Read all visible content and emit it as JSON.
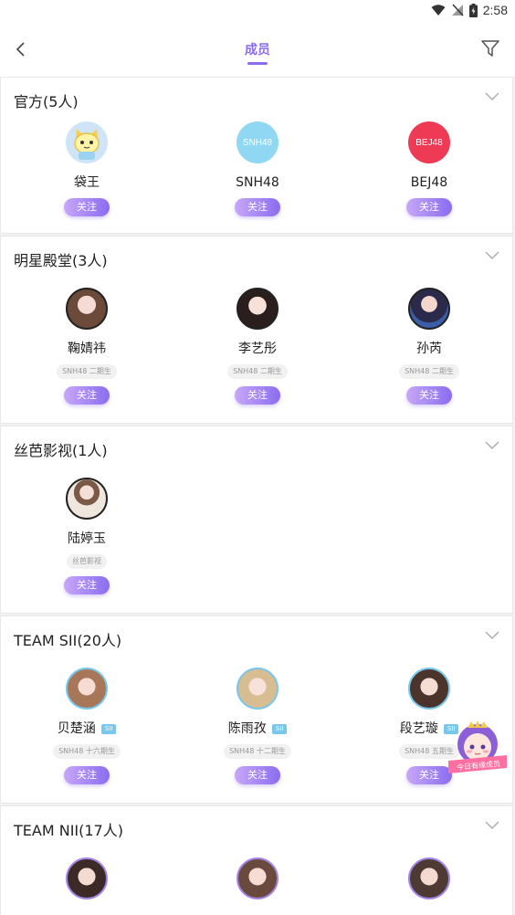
{
  "status": {
    "time": "2:58"
  },
  "header": {
    "title": "成员"
  },
  "sections": [
    {
      "title": "官方(5人)",
      "members": [
        {
          "name": "袋王",
          "follow": "关注"
        },
        {
          "name": "SNH48",
          "logo_text": "SNH48",
          "follow": "关注"
        },
        {
          "name": "BEJ48",
          "logo_text": "BEJ48",
          "follow": "关注"
        }
      ]
    },
    {
      "title": "明星殿堂(3人)",
      "members": [
        {
          "name": "鞠婧祎",
          "tag": "SNH48 二期生",
          "follow": "关注"
        },
        {
          "name": "李艺彤",
          "tag": "SNH48 二期生",
          "follow": "关注"
        },
        {
          "name": "孙芮",
          "tag": "SNH48 二期生",
          "follow": "关注"
        }
      ]
    },
    {
      "title": "丝芭影视(1人)",
      "members": [
        {
          "name": "陆婷玉",
          "tag": "丝芭影视",
          "follow": "关注"
        }
      ]
    },
    {
      "title": "TEAM SII(20人)",
      "members": [
        {
          "name": "贝楚涵",
          "badge": "SII",
          "tag": "SNH48 十六期生",
          "follow": "关注"
        },
        {
          "name": "陈雨孜",
          "badge": "SII",
          "tag": "SNH48 十二期生",
          "follow": "关注"
        },
        {
          "name": "段艺璇",
          "badge": "SII",
          "tag": "SNH48 五期生",
          "follow": "关注"
        }
      ]
    },
    {
      "title": "TEAM NII(17人)",
      "members": [
        {
          "name": ""
        },
        {
          "name": ""
        },
        {
          "name": ""
        }
      ]
    }
  ],
  "mascot": {
    "banner": "今日有缘成员"
  },
  "colors": {
    "accent": "#8b6cf0",
    "badge": "#78c7ec"
  }
}
